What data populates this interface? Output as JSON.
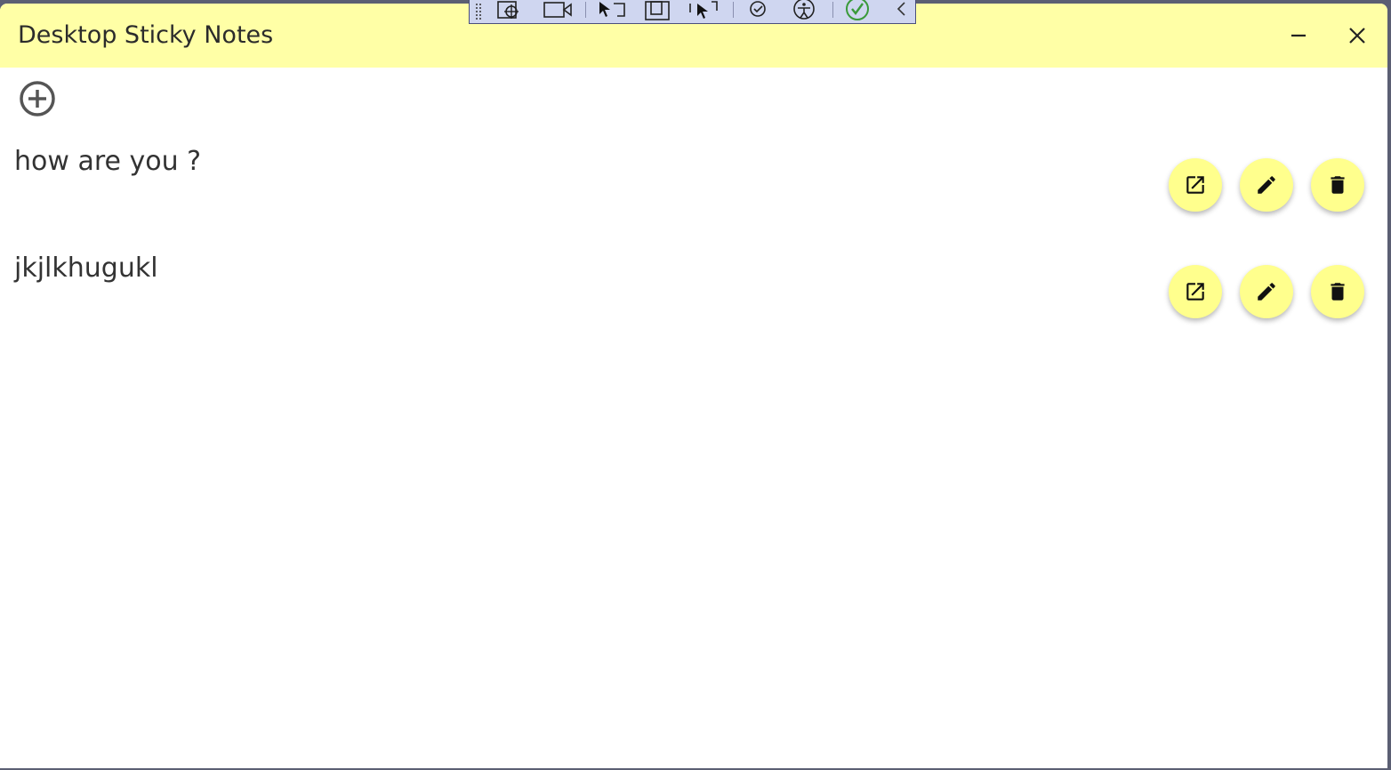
{
  "window": {
    "title": "Desktop Sticky Notes",
    "controls": {
      "minimize_icon": "minimize-icon",
      "close_icon": "close-icon"
    }
  },
  "toolbar": {
    "add_icon": "plus-circle-icon"
  },
  "notes": [
    {
      "text": "how are you ?"
    },
    {
      "text": "jkjlkhugukl"
    }
  ],
  "note_actions": [
    "open-external-icon",
    "edit-pencil-icon",
    "delete-trash-icon"
  ],
  "colors": {
    "titlebar": "#ffffa6",
    "fab": "#ffff8d",
    "debug_toolbar": "#cfd6f0"
  }
}
